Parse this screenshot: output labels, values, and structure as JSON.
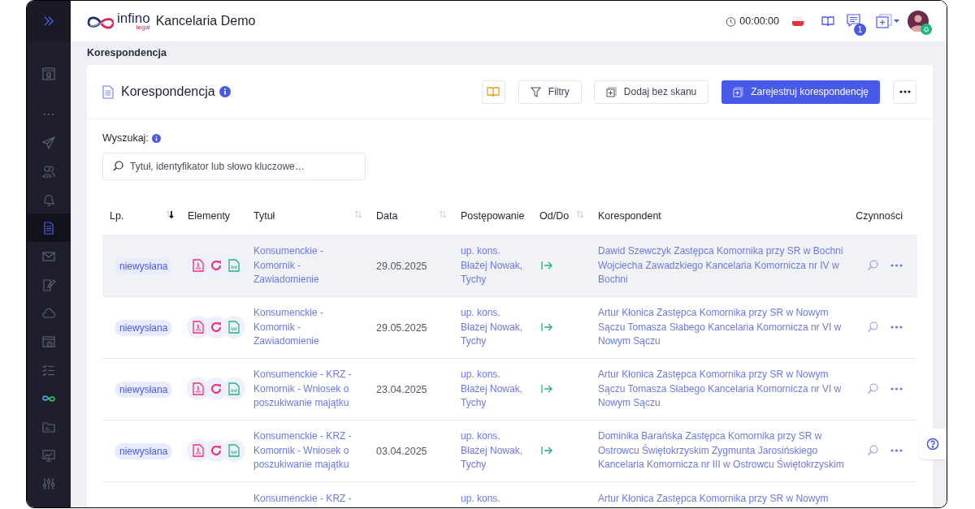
{
  "header": {
    "logo_text": "infino",
    "logo_subtext": "legal",
    "app_name": "Kancelaria Demo",
    "timer": "00:00:00",
    "messages_badge": "1"
  },
  "sidebar": {
    "items": [
      {
        "kind": "monitor",
        "selected": false
      },
      {
        "kind": "dots",
        "selected": false
      },
      {
        "kind": "send",
        "selected": false
      },
      {
        "kind": "users",
        "selected": false
      },
      {
        "kind": "bell",
        "selected": false
      },
      {
        "kind": "document",
        "selected": true
      },
      {
        "kind": "mail",
        "selected": false
      },
      {
        "kind": "edit",
        "selected": false
      },
      {
        "kind": "cloud",
        "selected": false
      },
      {
        "kind": "calendar",
        "selected": false
      },
      {
        "kind": "checklist",
        "selected": false
      },
      {
        "kind": "infinity",
        "selected": false
      },
      {
        "kind": "folder",
        "selected": false
      },
      {
        "kind": "chart",
        "selected": false
      },
      {
        "kind": "sliders",
        "selected": false
      }
    ]
  },
  "breadcrumb": "Korespondencja",
  "card": {
    "title": "Korespondencja",
    "toolbar": [
      {
        "kind": "icon"
      },
      {
        "kind": "outline",
        "label": "Filtry"
      },
      {
        "kind": "outline",
        "label": "Dodaj bez skanu"
      },
      {
        "kind": "primary",
        "label": "Zarejestruj korespondencję"
      },
      {
        "kind": "more"
      }
    ],
    "search": {
      "label": "Wyszukaj:",
      "placeholder": "Tytuł, identyfikator lub słowo kluczowe…"
    },
    "table": {
      "columns": [
        {
          "label": "Lp.",
          "sortable": true,
          "sorted": true
        },
        {
          "label": "Elementy",
          "sortable": false,
          "sorted": false
        },
        {
          "label": "Tytuł",
          "sortable": true,
          "sorted": false
        },
        {
          "label": "Data",
          "sortable": true,
          "sorted": false
        },
        {
          "label": "Postępowanie",
          "sortable": false,
          "sorted": false
        },
        {
          "label": "Od/Do",
          "sortable": true,
          "sorted": false
        },
        {
          "label": "Korespondent",
          "sortable": false,
          "sorted": false
        },
        {
          "label": "Czynności",
          "sortable": false,
          "sorted": false
        }
      ],
      "rows": [
        {
          "highlighted": true,
          "status": "niewysłana",
          "elements": [
            {
              "kind": "pdf"
            },
            {
              "kind": "redo"
            },
            {
              "kind": "word"
            }
          ],
          "title": "Konsumenckie - Komornik - Zawiadomienie",
          "date": "29.05.2025",
          "proceeding": "up. kons. Błażej Nowak, Tychy",
          "outgoing": true,
          "correspondent": "Dawid Szewczyk Zastępca Komornika przy SR w Bochni Wojciecha Zawadzkiego Kancelaria Komornicza nr IV w Bochni"
        },
        {
          "highlighted": false,
          "status": "niewysłana",
          "elements": [
            {
              "kind": "pdf"
            },
            {
              "kind": "redo"
            },
            {
              "kind": "word"
            }
          ],
          "title": "Konsumenckie - Komornik - Zawiadomienie",
          "date": "29.05.2025",
          "proceeding": "up. kons. Błażej Nowak, Tychy",
          "outgoing": true,
          "correspondent": "Artur Kłonica Zastępca Komornika przy SR w Nowym Sączu Tomasza Słabego Kancelaria Komornicza nr VI w Nowym Sączu"
        },
        {
          "highlighted": false,
          "status": "niewysłana",
          "elements": [
            {
              "kind": "pdf"
            },
            {
              "kind": "redo"
            },
            {
              "kind": "word"
            }
          ],
          "title": "Konsumenckie - KRZ - Komornik - Wniosek o poszukiwanie majątku",
          "date": "23.04.2025",
          "proceeding": "up. kons. Błażej Nowak, Tychy",
          "outgoing": true,
          "correspondent": "Artur Kłonica Zastępca Komornika przy SR w Nowym Sączu Tomasza Słabego Kancelaria Komornicza nr VI w Nowym Sączu"
        },
        {
          "highlighted": false,
          "status": "niewysłana",
          "elements": [
            {
              "kind": "pdf"
            },
            {
              "kind": "redo"
            },
            {
              "kind": "word"
            }
          ],
          "title": "Konsumenckie - KRZ - Komornik - Wniosek o poszukiwanie majątku",
          "date": "03.04.2025",
          "proceeding": "up. kons. Błażej Nowak, Tychy",
          "outgoing": true,
          "correspondent": "Dominika Barańska Zastępca Komornika przy SR w Ostrowcu Świętokrzyskim Zygmunta Jarosińskiego Kancelaria Komornicza nr III w Ostrowcu Świętokrzyskim"
        },
        {
          "highlighted": false,
          "title": "Konsumenckie - KRZ -",
          "proceeding": "up. kons.",
          "correspondent": "Artur Kłonica Zastępca Komornika przy SR w Nowym"
        }
      ]
    }
  }
}
